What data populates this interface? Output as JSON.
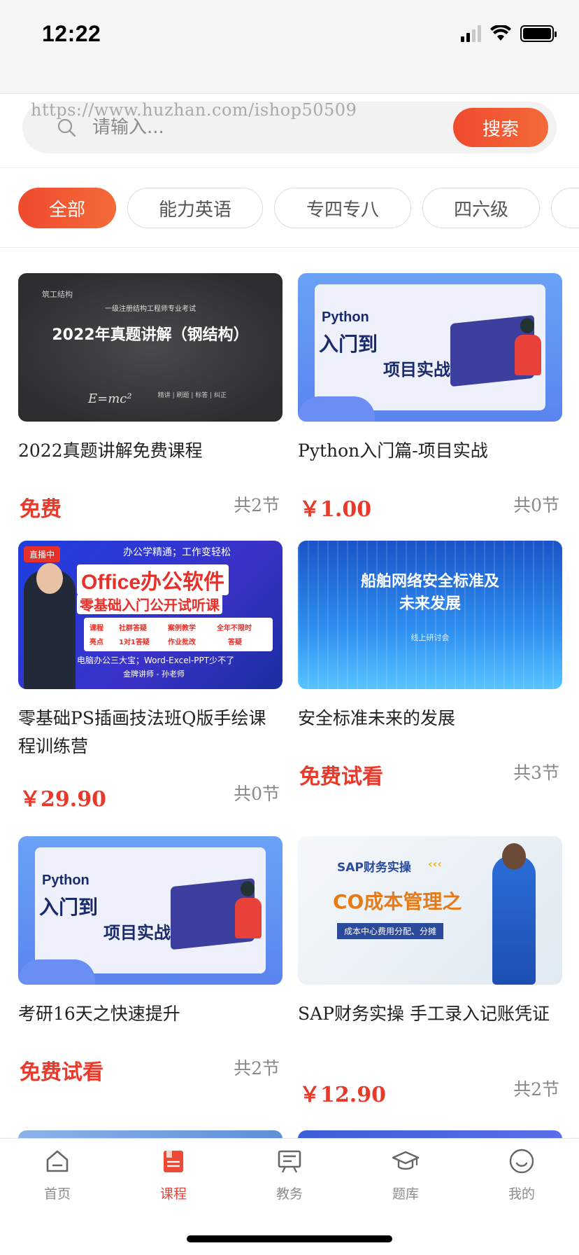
{
  "status_bar": {
    "time": "12:22"
  },
  "search": {
    "placeholder": "请输入...",
    "button_label": "搜索",
    "watermark": "https://www.huzhan.com/ishop50509"
  },
  "categories": [
    {
      "label": "全部",
      "active": true
    },
    {
      "label": "能力英语",
      "active": false
    },
    {
      "label": "专四专八",
      "active": false
    },
    {
      "label": "四六级",
      "active": false
    }
  ],
  "courses": [
    {
      "title": "2022真题讲解免费课程",
      "price": "免费",
      "lessons": "共2节",
      "thumb": {
        "corner": "筑工结构",
        "subtitle": "一级注册结构工程师专业考试",
        "headline": "2022年真题讲解（钢结构）",
        "footer": "精讲 | 刷题 | 标答 | 纠正",
        "formula": "E=mc²"
      }
    },
    {
      "title": "Python入门篇-项目实战",
      "price": "￥1.00",
      "lessons": "共0节",
      "thumb": {
        "word": "Python",
        "line1": "入门到",
        "line2": "项目实战"
      }
    },
    {
      "title": "零基础PS插画技法班Q版手绘课程训练营",
      "price": "￥29.90",
      "lessons": "共0节",
      "thumb": {
        "live": "直播中",
        "top": "办公学精通；工作变轻松",
        "headline": "Office办公软件",
        "sub": "零基础入门公开试听课",
        "boxes": [
          "课程",
          "亮点",
          "社群答疑",
          "1对1答疑",
          "案例教学",
          "作业批改",
          "全年不限时",
          "答疑"
        ],
        "footer": "电脑办公三大宝；Word-Excel-PPT少不了",
        "teacher": "金牌讲师 - 孙老师"
      }
    },
    {
      "title": "安全标准未来的发展",
      "price": "免费试看",
      "lessons": "共3节",
      "thumb": {
        "line1": "船舶网络安全标准及",
        "line2": "未来发展",
        "line3": "线上研讨会"
      }
    },
    {
      "title": "考研16天之快速提升",
      "price": "免费试看",
      "lessons": "共2节",
      "thumb": {
        "word": "Python",
        "line1": "入门到",
        "line2": "项目实战"
      }
    },
    {
      "title": "SAP财务实操 手工录入记账凭证",
      "price": "￥12.90",
      "lessons": "共2节",
      "thumb": {
        "top": "SAP财务实操",
        "arrows": "‹‹‹",
        "headline": "CO成本管理之",
        "band": "成本中心费用分配、分摊"
      }
    }
  ],
  "tabbar": [
    {
      "label": "首页",
      "icon": "home-icon",
      "active": false
    },
    {
      "label": "课程",
      "icon": "course-icon",
      "active": true
    },
    {
      "label": "教务",
      "icon": "academic-board-icon",
      "active": false
    },
    {
      "label": "题库",
      "icon": "graduation-cap-icon",
      "active": false
    },
    {
      "label": "我的",
      "icon": "profile-smile-icon",
      "active": false
    }
  ],
  "colors": {
    "accent": "#f04a2c",
    "price": "#e83a2a",
    "tab_active": "#e8423a"
  }
}
